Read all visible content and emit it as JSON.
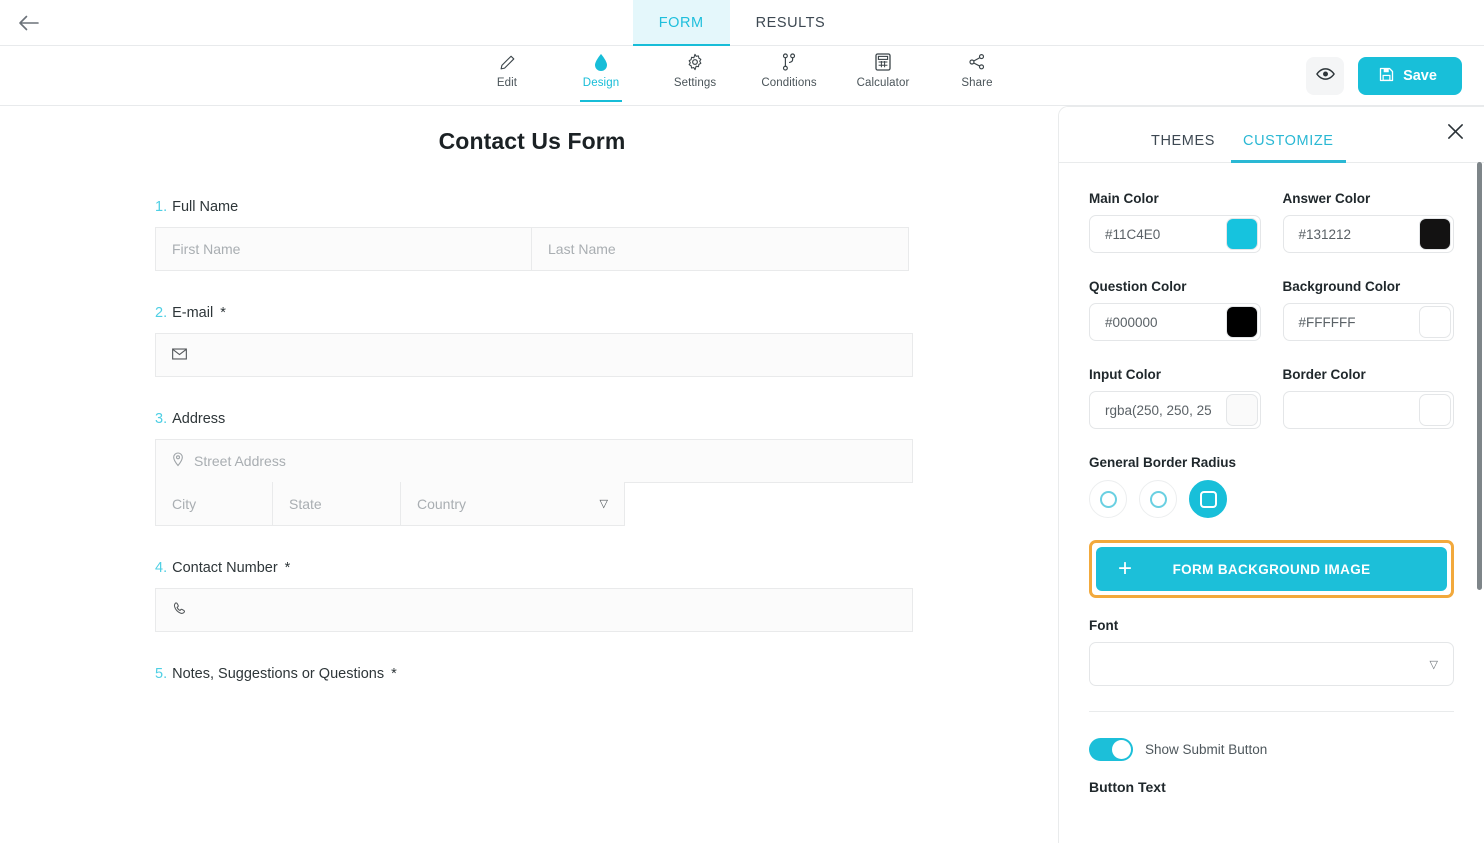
{
  "topbar": {
    "back_icon": "arrow-left-icon",
    "tabs": [
      {
        "label": "FORM",
        "active": true
      },
      {
        "label": "RESULTS",
        "active": false
      }
    ]
  },
  "toolbar": {
    "tools": [
      {
        "label": "Edit",
        "icon": "pencil-icon",
        "active": false
      },
      {
        "label": "Design",
        "icon": "droplet-icon",
        "active": true
      },
      {
        "label": "Settings",
        "icon": "gear-icon",
        "active": false
      },
      {
        "label": "Conditions",
        "icon": "branch-icon",
        "active": false
      },
      {
        "label": "Calculator",
        "icon": "calculator-icon",
        "active": false
      },
      {
        "label": "Share",
        "icon": "share-nodes-icon",
        "active": false
      }
    ],
    "preview_icon": "eye-icon",
    "save_label": "Save",
    "save_icon": "floppy-disk-icon",
    "accent_color": "#18BFD9"
  },
  "form": {
    "title": "Contact Us Form",
    "questions": [
      {
        "number": "1.",
        "label": "Full Name",
        "required": "",
        "fields": [
          {
            "placeholder": "First Name",
            "icon": ""
          },
          {
            "placeholder": "Last Name",
            "icon": ""
          }
        ]
      },
      {
        "number": "2.",
        "label": "E-mail",
        "required": "*",
        "fields": [
          {
            "placeholder": "",
            "icon": "envelope-icon"
          }
        ]
      },
      {
        "number": "3.",
        "label": "Address",
        "required": "",
        "fields": [
          {
            "placeholder": "Street Address",
            "icon": "map-pin-icon"
          },
          {
            "placeholder": "City",
            "icon": ""
          },
          {
            "placeholder": "State",
            "icon": ""
          },
          {
            "placeholder": "Country",
            "icon": "",
            "dropdown": true
          }
        ]
      },
      {
        "number": "4.",
        "label": "Contact Number",
        "required": "*",
        "fields": [
          {
            "placeholder": "",
            "icon": "phone-icon"
          }
        ]
      },
      {
        "number": "5.",
        "label": "Notes, Suggestions or Questions",
        "required": "*",
        "fields": []
      }
    ]
  },
  "panel": {
    "tabs": [
      {
        "label": "THEMES",
        "active": false
      },
      {
        "label": "CUSTOMIZE",
        "active": true
      }
    ],
    "close_icon": "close-icon",
    "colors": [
      {
        "label": "Main Color",
        "value": "#11C4E0",
        "swatch": "#16C3DE"
      },
      {
        "label": "Answer Color",
        "value": "#131212",
        "swatch": "#131212"
      },
      {
        "label": "Question Color",
        "value": "#000000",
        "swatch": "#000000"
      },
      {
        "label": "Background Color",
        "value": "#FFFFFF",
        "swatch": "#FFFFFF"
      },
      {
        "label": "Input Color",
        "value": "rgba(250, 250, 25",
        "swatch": "#FAFAFA"
      },
      {
        "label": "Border Color",
        "value": "",
        "swatch": "#FFFFFF"
      }
    ],
    "border_radius": {
      "label": "General Border Radius",
      "options": [
        {
          "name": "radius-small",
          "selected": false
        },
        {
          "name": "radius-medium",
          "selected": false
        },
        {
          "name": "radius-large",
          "selected": true
        }
      ]
    },
    "background_image_button": {
      "label": "FORM BACKGROUND IMAGE",
      "plus_icon": "plus-icon",
      "highlighted": true,
      "highlight_color": "#F2A93C"
    },
    "font": {
      "label": "Font",
      "value": "",
      "chevron_icon": "chevron-down-icon"
    },
    "submit_toggle": {
      "label": "Show Submit Button",
      "enabled": true
    },
    "button_text_label": "Button Text"
  }
}
